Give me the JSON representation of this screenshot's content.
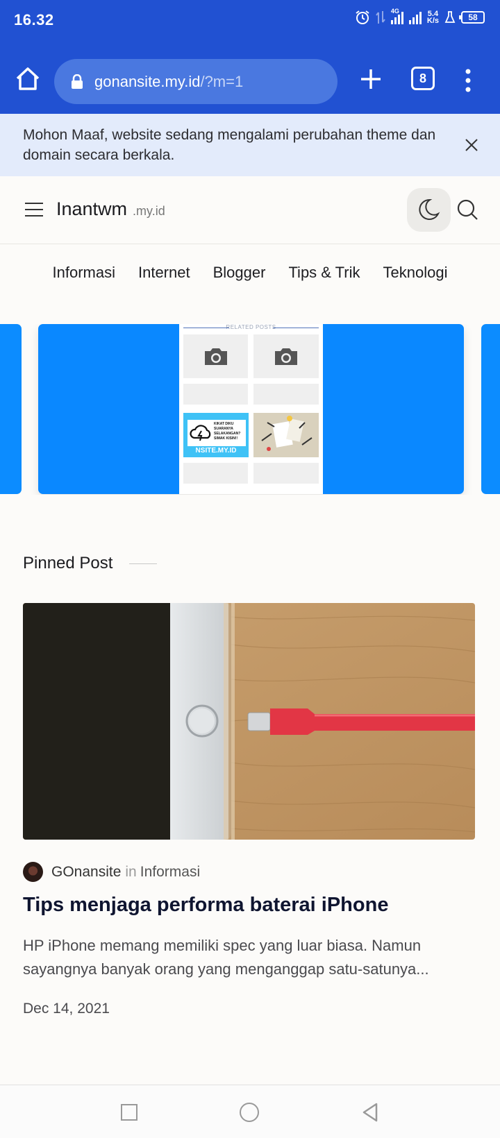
{
  "status_bar": {
    "time": "16.32",
    "network": "4G",
    "speed_value": "5.4",
    "speed_unit": "K/s",
    "battery": "58"
  },
  "browser": {
    "url_host": "gonansite.my.id",
    "url_path": "/?m=1",
    "tab_count": "8"
  },
  "notice": {
    "text": "Mohon Maaf, website sedang mengalami perubahan theme dan domain secara berkala."
  },
  "header": {
    "logo": "Inantwm",
    "logo_suffix": ".my.id"
  },
  "categories": [
    "Informasi",
    "Internet",
    "Blogger",
    "Tips & Trik",
    "Teknologi"
  ],
  "slider": {
    "mock_title": "RELATED POSTS",
    "cloud_card_text": "KIKAT DIKU SUARANYA SELAKANGAN? SIMAK KISIN!!",
    "cloud_site_text": "NSITE.MY.ID"
  },
  "pinned": {
    "heading": "Pinned Post",
    "author": "GOnansite",
    "in_word": "in",
    "category": "Informasi",
    "title": "Tips menjaga performa baterai iPhone",
    "excerpt": "HP iPhone memang memiliki spec yang luar biasa. Namun sayangnya banyak orang yang menganggap satu-satunya...",
    "date": "Dec 14, 2021"
  },
  "colors": {
    "browser_blue": "#2151d2",
    "slide_blue": "#0a88ff",
    "notice_bg": "#e3ebfb",
    "cable_red": "#e23645"
  }
}
